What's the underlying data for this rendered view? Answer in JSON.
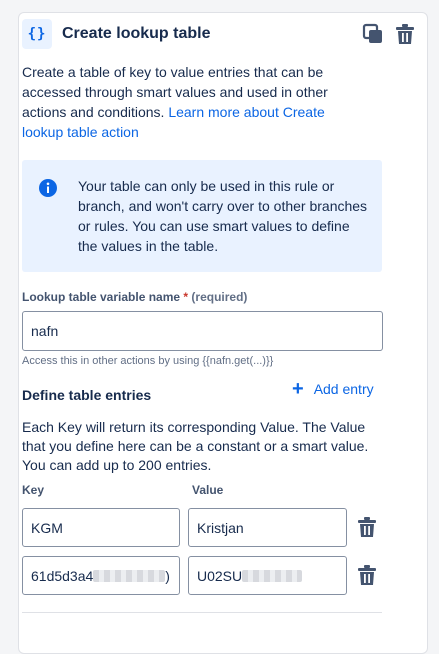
{
  "header": {
    "icon_text": "{}",
    "title": "Create lookup table"
  },
  "description": {
    "text": "Create a table of key to value entries that can be accessed through smart values and used in other actions and conditions. ",
    "link": "Learn more about Create lookup table action"
  },
  "info_banner": {
    "text": "Your table can only be used in this rule or branch, and won't carry over to other branches or rules. You can use smart values to define the values in the table."
  },
  "variable_field": {
    "label": "Lookup table variable name",
    "required_mark": "*",
    "required_text": "(required)",
    "value": "nafn",
    "helper": "Access this in other actions by using {{nafn.get(...)}}"
  },
  "entries": {
    "title": "Define table entries",
    "add_label": "Add entry",
    "description": "Each Key will return its corresponding Value. The Value that you define here can be a constant or a smart value. You can add up to 200 entries.",
    "key_column": "Key",
    "value_column": "Value",
    "rows": [
      {
        "key": "KGM",
        "value": "Kristjan"
      },
      {
        "key": "61d5d3a4",
        "key_suffix": ")",
        "value": "U02SU"
      }
    ]
  },
  "colors": {
    "accent": "#0c66e4",
    "info_bg": "#e9f2ff",
    "required": "#c9372c"
  }
}
